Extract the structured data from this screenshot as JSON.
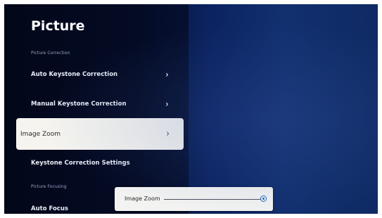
{
  "page_title": "Picture",
  "sections": {
    "correction_header": "Picture Correction",
    "focusing_header": "Picture Focusing"
  },
  "menu": {
    "auto_keystone": "Auto Keystone Correction",
    "manual_keystone": "Manual Keystone Correction",
    "image_zoom": "Image Zoom",
    "keystone_settings": "Keystone Correction Settings",
    "auto_focus": "Auto Focus"
  },
  "chevron": "›",
  "zoom_dialog": {
    "label": "Image Zoom",
    "slider_value_fraction": 1.0
  },
  "colors": {
    "accent": "#1d69c7",
    "selected_bg": "#f5f4ef"
  }
}
